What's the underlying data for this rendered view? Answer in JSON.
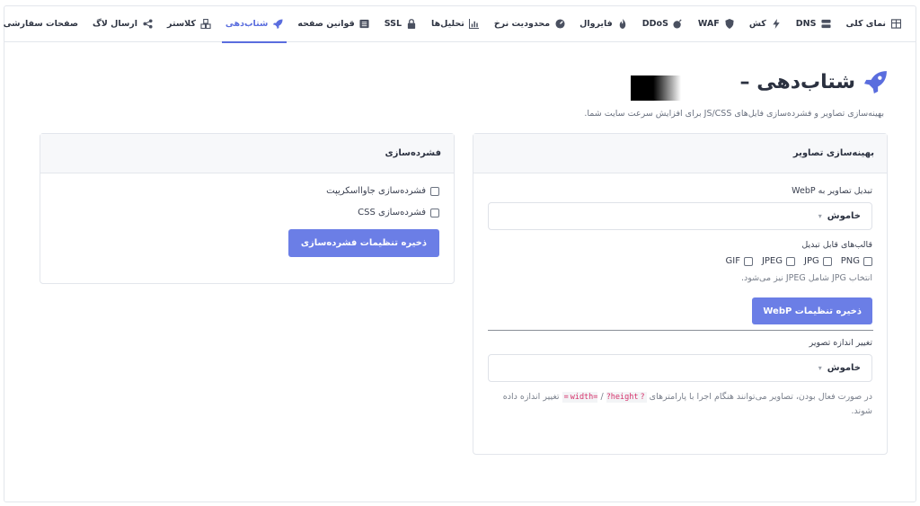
{
  "tabs": [
    {
      "label": "نمای کلی",
      "icon": "table-icon"
    },
    {
      "label": "DNS",
      "icon": "server-icon"
    },
    {
      "label": "کش",
      "icon": "bolt-icon"
    },
    {
      "label": "WAF",
      "icon": "shield-icon"
    },
    {
      "label": "DDoS",
      "icon": "bomb-icon"
    },
    {
      "label": "فایروال",
      "icon": "fire-icon"
    },
    {
      "label": "محدودیت نرخ",
      "icon": "gauge-icon"
    },
    {
      "label": "تحلیل‌ها",
      "icon": "chart-icon"
    },
    {
      "label": "SSL",
      "icon": "lock-icon"
    },
    {
      "label": "قوانین صفحه",
      "icon": "list-icon"
    },
    {
      "label": "شتاب‌دهی",
      "icon": "rocket-icon",
      "active": true
    },
    {
      "label": "کلاستر",
      "icon": "cubes-icon"
    },
    {
      "label": "ارسال لاگ",
      "icon": "share-icon"
    },
    {
      "label": "صفحات سفارشی",
      "icon": ""
    }
  ],
  "header": {
    "title": "شتاب‌دهی –",
    "subtitle": "بهینه‌سازی تصاویر و فشرده‌سازی فایل‌های JS/CSS برای افزایش سرعت سایت شما."
  },
  "image_opt": {
    "title": "بهینه‌سازی تصاویر",
    "webp_label": "تبدیل تصاویر به WebP",
    "webp_value": "خاموش",
    "formats_label": "قالب‌های قابل تبدیل",
    "formats": [
      "PNG",
      "JPG",
      "JPEG",
      "GIF"
    ],
    "formats_hint": "انتخاب JPG شامل JPEG نیز می‌شود.",
    "save_webp": "ذخیره تنظیمات WebP",
    "resize_label": "تغییر اندازه تصویر",
    "resize_value": "خاموش",
    "resize_hint_a": "در صورت فعال بودن، تصاویر می‌توانند هنگام اجرا با پارامترهای",
    "param_width": "?width=",
    "param_sep": "/",
    "param_height": "?height=",
    "resize_hint_b": "تغییر اندازه داده شوند."
  },
  "minify": {
    "title": "فشرده‌سازی",
    "js_label": "فشرده‌سازی جاوااسکریپت",
    "css_label": "فشرده‌سازی CSS",
    "save": "ذخیره تنظیمات فشرده‌سازی"
  },
  "colors": {
    "accent": "#5a6dde",
    "button": "#6b7ee6"
  }
}
